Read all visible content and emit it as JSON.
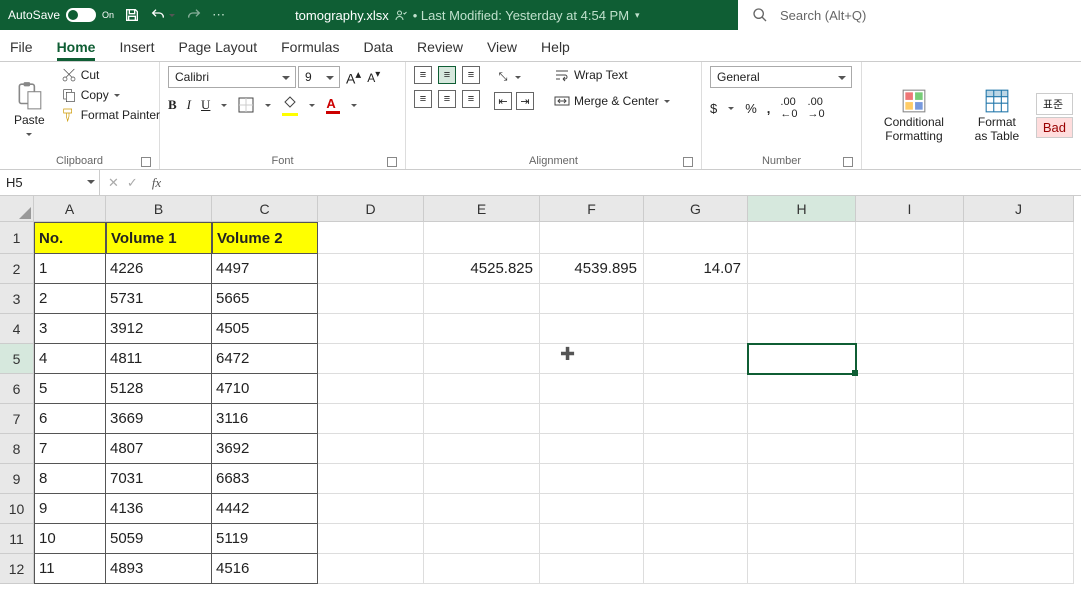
{
  "titlebar": {
    "autosave_label": "AutoSave",
    "autosave_state": "On",
    "filename": "tomography.xlsx",
    "modified": "• Last Modified: Yesterday at 4:54 PM",
    "search_placeholder": "Search (Alt+Q)"
  },
  "tabs": [
    "File",
    "Home",
    "Insert",
    "Page Layout",
    "Formulas",
    "Data",
    "Review",
    "View",
    "Help"
  ],
  "active_tab": "Home",
  "ribbon": {
    "clipboard": {
      "paste": "Paste",
      "cut": "Cut",
      "copy": "Copy",
      "fmt": "Format Painter",
      "label": "Clipboard"
    },
    "font": {
      "name": "Calibri",
      "size": "9",
      "label": "Font"
    },
    "alignment": {
      "wrap": "Wrap Text",
      "merge": "Merge & Center",
      "label": "Alignment"
    },
    "number": {
      "format": "General",
      "label": "Number"
    },
    "styles": {
      "cond": "Conditional Formatting",
      "table": "Format as Table",
      "bad": "Bad"
    }
  },
  "formula_bar": {
    "namebox": "H5",
    "formula": ""
  },
  "columns": [
    "A",
    "B",
    "C",
    "D",
    "E",
    "F",
    "G",
    "H",
    "I",
    "J"
  ],
  "row_headers": [
    "1",
    "2",
    "3",
    "4",
    "5",
    "6",
    "7",
    "8",
    "9",
    "10",
    "11",
    "12"
  ],
  "header_row": [
    "No.",
    "Volume 1",
    "Volume 2"
  ],
  "data_rows": [
    [
      "1",
      "4226",
      "4497"
    ],
    [
      "2",
      "5731",
      "5665"
    ],
    [
      "3",
      "3912",
      "4505"
    ],
    [
      "4",
      "4811",
      "6472"
    ],
    [
      "5",
      "5128",
      "4710"
    ],
    [
      "6",
      "3669",
      "3116"
    ],
    [
      "7",
      "4807",
      "3692"
    ],
    [
      "8",
      "7031",
      "6683"
    ],
    [
      "9",
      "4136",
      "4442"
    ],
    [
      "10",
      "5059",
      "5119"
    ],
    [
      "11",
      "4893",
      "4516"
    ]
  ],
  "floating": {
    "E2": "4525.825",
    "F2": "4539.895",
    "G2": "14.07"
  },
  "selected_cell": "H5",
  "active_column": "H",
  "active_row": "5"
}
